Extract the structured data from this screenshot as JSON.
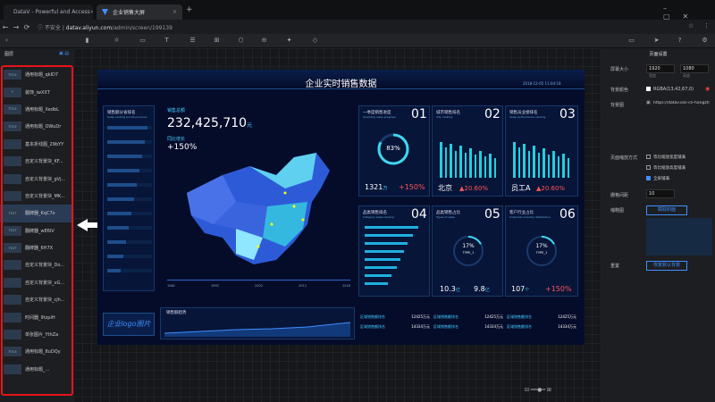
{
  "browser": {
    "tabs": [
      {
        "title": "DataV - Powerful and Access"
      },
      {
        "title": "企业销售大屏"
      }
    ],
    "new_tab": "+",
    "not_secure": "不安全",
    "url_domain": "datav.aliyun.com",
    "url_path": "/admin/screen/199139"
  },
  "layers": {
    "header": "图层",
    "items": [
      {
        "thumb": "TITLE",
        "label": "通用标题_qkID7"
      },
      {
        "thumb": "Y",
        "label": "装饰_iwXXT"
      },
      {
        "thumb": "TITLE",
        "label": "通用标题_XedbL"
      },
      {
        "thumb": "TITLE",
        "label": "通用标题_OWuDr"
      },
      {
        "thumb": "",
        "label": "基本折线图_29bYY"
      },
      {
        "thumb": "",
        "label": "自定义背景块_KF..."
      },
      {
        "thumb": "",
        "label": "自定义背景块_gVj..."
      },
      {
        "thumb": "",
        "label": "自定义背景块_MK..."
      },
      {
        "thumb": "TEXT",
        "label": "翻牌器_KqC7x"
      },
      {
        "thumb": "TEXT",
        "label": "翻牌器_wE6IV"
      },
      {
        "thumb": "TEXT",
        "label": "翻牌器_6H7X"
      },
      {
        "thumb": "",
        "label": "自定义背景块_Do..."
      },
      {
        "thumb": "",
        "label": "自定义背景块_vG..."
      },
      {
        "thumb": "",
        "label": "自定义背景块_cjh..."
      },
      {
        "thumb": "",
        "label": "时间器_9tzpiH"
      },
      {
        "thumb": "",
        "label": "单张图片_YthZa"
      },
      {
        "thumb": "TITLE",
        "label": "通用标题_8uDQy"
      },
      {
        "thumb": "",
        "label": "通用标题_..."
      }
    ]
  },
  "screen": {
    "title": "企业实时销售数据",
    "datetime": "2018-12-05 11:04:18",
    "left_card": {
      "title": "销售额分省排名",
      "subtitle": "Sales ranking points province"
    },
    "total_label": "销售总额",
    "total_value": "232,425,710",
    "total_unit": "元",
    "growth_label": "同比增长",
    "growth_value": "+150%",
    "timeline": [
      "1982",
      "1992",
      "2002",
      "2012",
      "2018"
    ],
    "card1": {
      "title": "一季度销售进度",
      "sub": "Quarterly sales progress",
      "num": "01",
      "pct": "83%",
      "value": "1321",
      "unit": "万",
      "growth": "+150%"
    },
    "card2": {
      "title": "城市销售排名",
      "sub": "City ranking",
      "num": "02",
      "city": "北京",
      "growth": "20.60%"
    },
    "card3": {
      "title": "销售员业绩排名",
      "sub": "Sales performance ranking",
      "num": "03",
      "person": "员工A",
      "growth": "20.60%"
    },
    "card4": {
      "title": "品类销售排名",
      "sub": "Category sales ranking",
      "num": "04"
    },
    "card5": {
      "title": "品类销售占比",
      "sub": "Types of sales",
      "num": "05",
      "pct": "17%",
      "type": "TYPE_1",
      "v1": "10.3",
      "u1": "亿",
      "v2": "9.8",
      "u2": "亿"
    },
    "card6": {
      "title": "客户行业占比",
      "sub": "Customer industry distribution",
      "num": "06",
      "pct": "17%",
      "type": "TYPE_1",
      "v1": "107",
      "u1": "个",
      "v2": "+150%"
    },
    "logo": "企业logo图片",
    "trend_title": "销售额趋势",
    "bottom_rows": [
      {
        "label": "区域销售额排名",
        "value": "12425万元"
      },
      {
        "label": "区域销售额排名",
        "value": "14334万元"
      }
    ]
  },
  "right_panel": {
    "header": "页面设置",
    "size_label": "屏幕大小",
    "width": "1920",
    "height": "1080",
    "w_label": "宽度",
    "h_label": "高度",
    "bg_color_label": "背景颜色",
    "bg_color_value": "RGBA(13,42,67,0)",
    "bg_image_label": "背景图",
    "bg_image_url": "https://datav.oss-cn-hangzh",
    "scale_label": "页面缩放方式",
    "scale_options": [
      "等比缩放宽度铺满",
      "等比缩放高度铺满",
      "全屏铺满"
    ],
    "grid_label": "栅格间距",
    "grid_value": "10",
    "thumb_label": "缩略图",
    "thumb_btn": "截取封面",
    "reset_label": "重置",
    "reset_btn": "恢复默认背景"
  }
}
